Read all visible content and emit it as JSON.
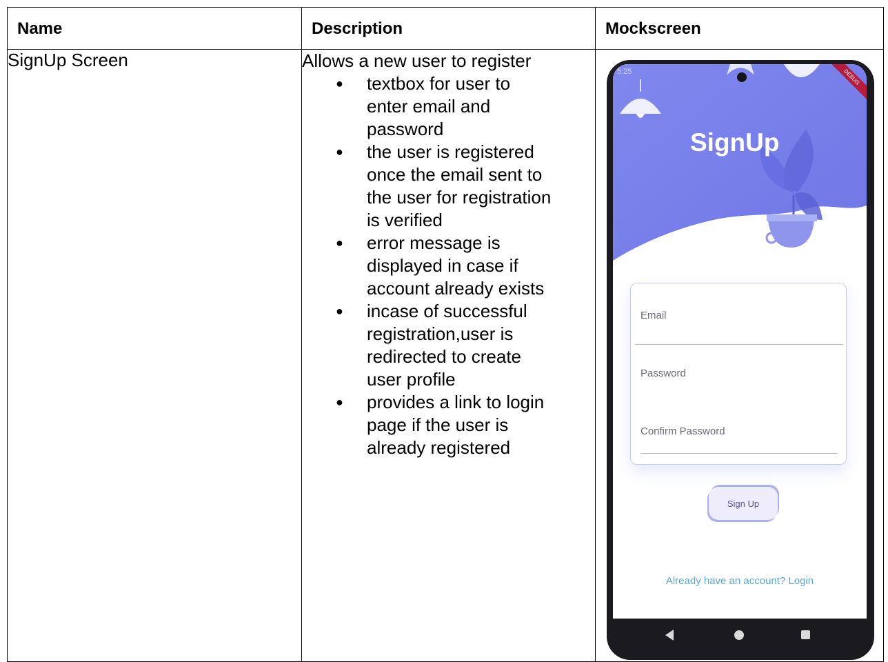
{
  "table": {
    "headers": [
      "Name",
      "Description",
      "Mockscreen"
    ],
    "row": {
      "name": "SignUp Screen",
      "description_intro": "Allows a new user to register",
      "bullets": [
        [
          "textbox for user to",
          "enter email and",
          "password"
        ],
        [
          "the user is registered",
          "once the email sent to",
          "the user for registration",
          "is verified"
        ],
        [
          "error message is",
          "displayed in case if",
          "account already exists"
        ],
        [
          "incase of successful",
          "registration,user is",
          "redirected to create",
          "user profile"
        ],
        [
          "provides a link to login",
          "page if the user is",
          "already registered"
        ]
      ]
    }
  },
  "mockscreen": {
    "status_time": "5:25",
    "debug_banner": "DEBUG",
    "title": "SignUp",
    "fields": {
      "email_label": "Email",
      "password_label": "Password",
      "confirm_label": "Confirm Password"
    },
    "signup_button": "Sign Up",
    "login_link": "Already have an account? Login",
    "nav_icons": [
      "back-icon",
      "home-icon",
      "recent-apps-icon"
    ],
    "colors": {
      "header_blue": "#7d84ec",
      "link": "#5aa7d8",
      "phone_frame": "#1a1a1f"
    }
  }
}
